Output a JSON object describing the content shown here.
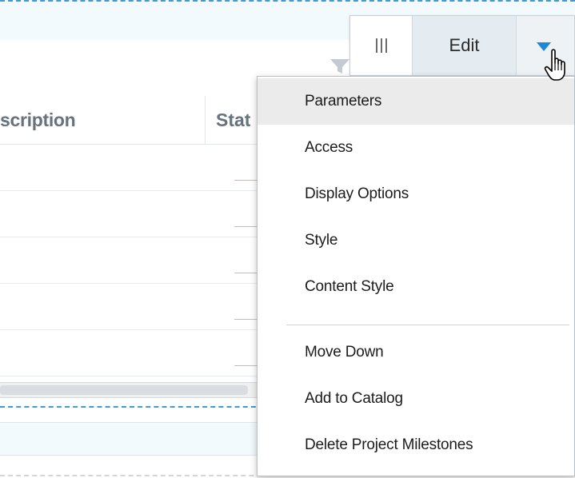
{
  "table": {
    "columns": [
      {
        "label": "scription"
      },
      {
        "label": "Stat"
      }
    ],
    "row_count": 5
  },
  "toolbar": {
    "edit_label": "Edit",
    "grip_icon": "column-grip-icon",
    "dropdown_icon": "caret-down-icon"
  },
  "menu": {
    "items": [
      {
        "label": "Parameters",
        "highlighted": true
      },
      {
        "label": "Access"
      },
      {
        "label": "Display Options"
      },
      {
        "label": "Style"
      },
      {
        "label": "Content Style"
      },
      {
        "label": "Move Down"
      },
      {
        "label": "Add to Catalog"
      },
      {
        "label": "Delete Project Milestones"
      }
    ]
  },
  "colors": {
    "accent_blue": "#1e88d8",
    "dashed_border": "#3d9bd6",
    "edit_bg": "#e4ecf1",
    "menu_hover": "#ebebeb"
  }
}
